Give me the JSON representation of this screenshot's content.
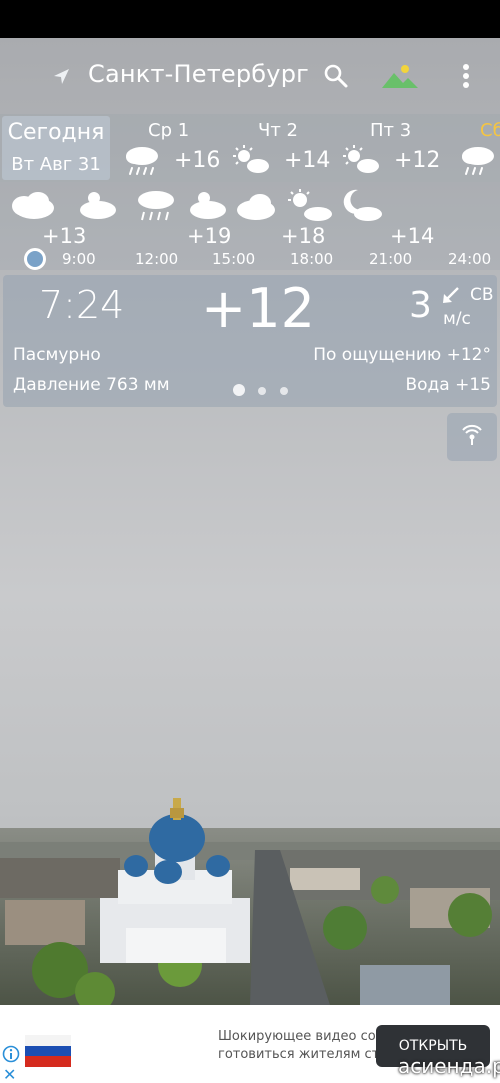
{
  "header": {
    "city": "Санкт-Петербург",
    "location_icon": "navigation-arrow-icon",
    "search_icon": "search-icon",
    "background_icon": "landscape-image-icon",
    "menu_icon": "more-vertical-icon"
  },
  "days": {
    "today_label": "Сегодня",
    "today_date": "Вт Авг 31",
    "items": [
      {
        "name": "Ср 1",
        "temp": "+16",
        "icon": "rain-cloud-icon"
      },
      {
        "name": "Чт 2",
        "temp": "+14",
        "icon": "sun-cloud-icon"
      },
      {
        "name": "Пт 3",
        "temp": "+12",
        "icon": "sun-cloud-icon"
      },
      {
        "name": "Сб",
        "temp": "",
        "icon": "rain-cloud-icon"
      }
    ]
  },
  "hourly": {
    "icons": [
      "cloud-icon",
      "sun-cloud-icon",
      "rain-cloud-icon",
      "sun-cloud-icon",
      "cloud-icon",
      "sun-cloud-icon",
      "moon-cloud-icon"
    ],
    "temps": [
      "+13",
      "+19",
      "+18",
      "+14"
    ],
    "times": [
      "9:00",
      "12:00",
      "15:00",
      "18:00",
      "21:00",
      "24:00"
    ]
  },
  "current": {
    "time": "7:24",
    "temp": "+12",
    "wind_speed": "3",
    "wind_dir": "СВ",
    "wind_unit": "м/с",
    "condition": "Пасмурно",
    "feels_like": "По ощущению +12°",
    "pressure": "Давление 763 мм",
    "water": "Вода +15",
    "page_count": 3,
    "active_page": 1
  },
  "radar_icon": "radar-broadcast-icon",
  "ad": {
    "line1": "Шокирующее видео со",
    "line2": "готовиться жителям ст",
    "button": "ОТКРЫТЬ",
    "info_icon": "info-icon",
    "close_icon": "close-icon"
  },
  "watermark": "асиенда.ру",
  "colors": {
    "accent_day": "#f5c542",
    "dot_now": "#7aa2c8",
    "ad_button": "#2f3236"
  }
}
